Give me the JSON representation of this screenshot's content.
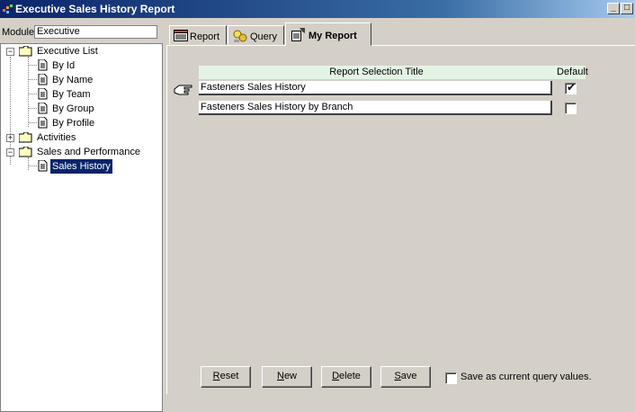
{
  "window": {
    "title": "Executive Sales History Report",
    "controls": [
      "_",
      "□",
      "✕"
    ]
  },
  "module": {
    "label": "Module:",
    "value": "Executive"
  },
  "tree": [
    {
      "label": "Executive List",
      "type": "folder",
      "expanded": true,
      "level": 0
    },
    {
      "label": "By Id",
      "type": "doc",
      "level": 1
    },
    {
      "label": "By Name",
      "type": "doc",
      "level": 1
    },
    {
      "label": "By Team",
      "type": "doc",
      "level": 1
    },
    {
      "label": "By Group",
      "type": "doc",
      "level": 1
    },
    {
      "label": "By Profile",
      "type": "doc",
      "level": 1
    },
    {
      "label": "Activities",
      "type": "folder",
      "expanded": false,
      "level": 0
    },
    {
      "label": "Sales and Performance",
      "type": "folder",
      "expanded": true,
      "level": 0
    },
    {
      "label": "Sales History",
      "type": "doc",
      "level": 1,
      "selected": true
    }
  ],
  "tabs": [
    {
      "label": "Report",
      "icon": "report-icon",
      "active": false
    },
    {
      "label": "Query",
      "icon": "query-icon",
      "active": false
    },
    {
      "label": "My Report",
      "icon": "my-report-icon",
      "active": true
    }
  ],
  "report_table": {
    "header_title": "Report Selection Title",
    "header_default": "Default",
    "rows": [
      {
        "title": "Fasteners Sales History",
        "default": true
      },
      {
        "title": "Fasteners Sales History by Branch",
        "default": false
      }
    ]
  },
  "buttons": {
    "reset": {
      "accel": "R",
      "rest": "eset"
    },
    "new": {
      "accel": "N",
      "rest": "ew"
    },
    "delete": {
      "accel": "D",
      "rest": "elete"
    },
    "save": {
      "accel": "S",
      "rest": "ave"
    }
  },
  "save_query": {
    "label": "Save as current query values.",
    "checked": false
  },
  "colors": {
    "titlebar_start": "#0a246a",
    "titlebar_end": "#a6caf0",
    "selection": "#0a246a",
    "header_bg": "#e4f4e4",
    "face": "#d4d0c8"
  }
}
